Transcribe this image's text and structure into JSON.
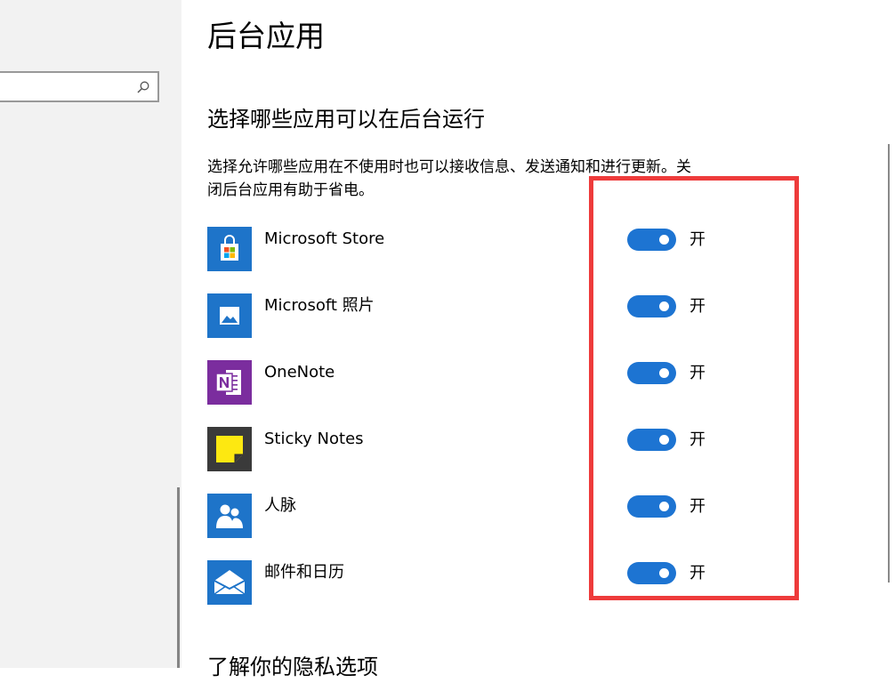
{
  "page": {
    "title": "后台应用",
    "section_title": "选择哪些应用可以在后台运行",
    "description": "选择允许哪些应用在不使用时也可以接收信息、发送通知和进行更新。关闭后台应用有助于省电。",
    "bottom_section_title": "了解你的隐私选项"
  },
  "search": {
    "placeholder": "",
    "icon": "search-icon"
  },
  "apps": [
    {
      "name": "Microsoft Store",
      "icon": "store-icon",
      "state_label": "开",
      "on": true
    },
    {
      "name": "Microsoft 照片",
      "icon": "photos-icon",
      "state_label": "开",
      "on": true
    },
    {
      "name": "OneNote",
      "icon": "onenote-icon",
      "state_label": "开",
      "on": true
    },
    {
      "name": "Sticky Notes",
      "icon": "sticky-notes-icon",
      "state_label": "开",
      "on": true
    },
    {
      "name": "人脉",
      "icon": "people-icon",
      "state_label": "开",
      "on": true
    },
    {
      "name": "邮件和日历",
      "icon": "mail-calendar-icon",
      "state_label": "开",
      "on": true
    }
  ],
  "colors": {
    "accent": "#1d74d2",
    "annotation": "#ee3b3b",
    "sidebar_bg": "#f2f2f2",
    "app_tile_blue": "#1e74c9",
    "onenote_purple": "#7b2d9e",
    "sticky_dark": "#3a3a3a",
    "sticky_yellow": "#fde811"
  }
}
